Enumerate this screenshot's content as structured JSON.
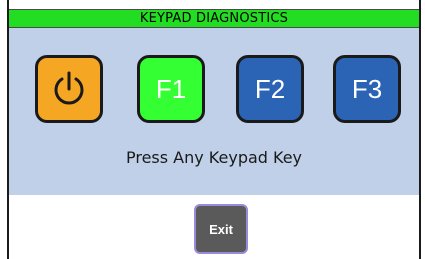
{
  "header": {
    "title": "KEYPAD DIAGNOSTICS"
  },
  "keys": [
    {
      "label": "",
      "icon": "power-icon",
      "color": "#f5a623"
    },
    {
      "label": "F1",
      "color": "#33ff33"
    },
    {
      "label": "F2",
      "color": "#2b63b5"
    },
    {
      "label": "F3",
      "color": "#2b63b5"
    }
  ],
  "prompt": "Press Any Keypad Key",
  "footer": {
    "exit_label": "Exit"
  },
  "colors": {
    "title_bar": "#22dd22",
    "panel": "#bfd0e8",
    "exit_button": "#5a5a5a"
  }
}
